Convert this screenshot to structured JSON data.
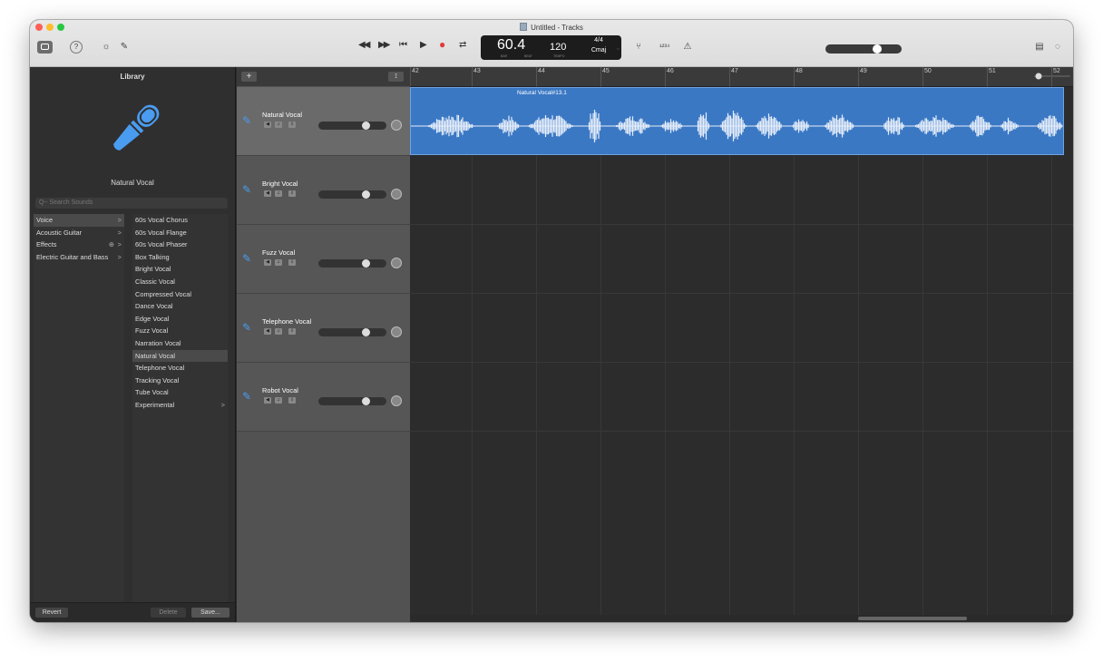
{
  "window": {
    "title": "Untitled - Tracks",
    "traffic_colors": [
      "#fe5f57",
      "#febc2e",
      "#28c840"
    ]
  },
  "toolbar": {
    "help": "?",
    "smart_controls": "☼",
    "editors": "✎",
    "rewind": "◀◀",
    "forward": "▶▶",
    "to_start": "⏮",
    "play": "▶",
    "record": "●",
    "cycle": "⇄",
    "tuner": "⑂",
    "count_in": "¹²³⁴",
    "metronome": "⚠",
    "notepad": "▤",
    "loops": "◌",
    "record_color": "#e23a3a"
  },
  "lcd": {
    "bar": "60.4",
    "tempo": "120",
    "signature": "4/4",
    "key": "Cmaj",
    "bar_label": "BAR",
    "beat_label": "BEAT",
    "tempo_label": "TEMPO",
    "chevron": "⌄"
  },
  "library": {
    "title": "Library",
    "selected_patch": "Natural Vocal",
    "search_placeholder": "Q~ Search Sounds",
    "categories": [
      {
        "label": "Voice",
        "chev": ">"
      },
      {
        "label": "Acoustic Guitar",
        "chev": ">"
      },
      {
        "label": "Effects",
        "chev": ">",
        "plus": "⊕"
      },
      {
        "label": "Electric Guitar and Bass",
        "chev": ">"
      }
    ],
    "sounds": [
      "60s Vocal Chorus",
      "60s Vocal Flange",
      "60s Vocal Phaser",
      "Box Talking",
      "Bright Vocal",
      "Classic Vocal",
      "Compressed Vocal",
      "Dance Vocal",
      "Edge Vocal",
      "Fuzz Vocal",
      "Narration Vocal",
      "Natural Vocal",
      "Telephone Vocal",
      "Tracking Vocal",
      "Tube Vocal",
      "Experimental"
    ],
    "experimental_chev": ">",
    "revert": "Revert",
    "delete": "Delete",
    "save": "Save..."
  },
  "tracks_header": {
    "add": "+",
    "filter": "⟟"
  },
  "tracks": [
    {
      "name": "Natural Vocal"
    },
    {
      "name": "Bright Vocal"
    },
    {
      "name": "Fuzz Vocal"
    },
    {
      "name": "Telephone Vocal"
    },
    {
      "name": "Robot Vocal"
    }
  ],
  "track_controls": {
    "mute": "◀",
    "headphones": "♫",
    "record_enable": "⇩",
    "mic": "🎤"
  },
  "ruler": {
    "bars": [
      "42",
      "43",
      "44",
      "45",
      "46",
      "47",
      "48",
      "49",
      "50",
      "51",
      "52"
    ]
  },
  "region": {
    "name": "Natural Vocal#13.1",
    "color": "#3b78c4"
  }
}
